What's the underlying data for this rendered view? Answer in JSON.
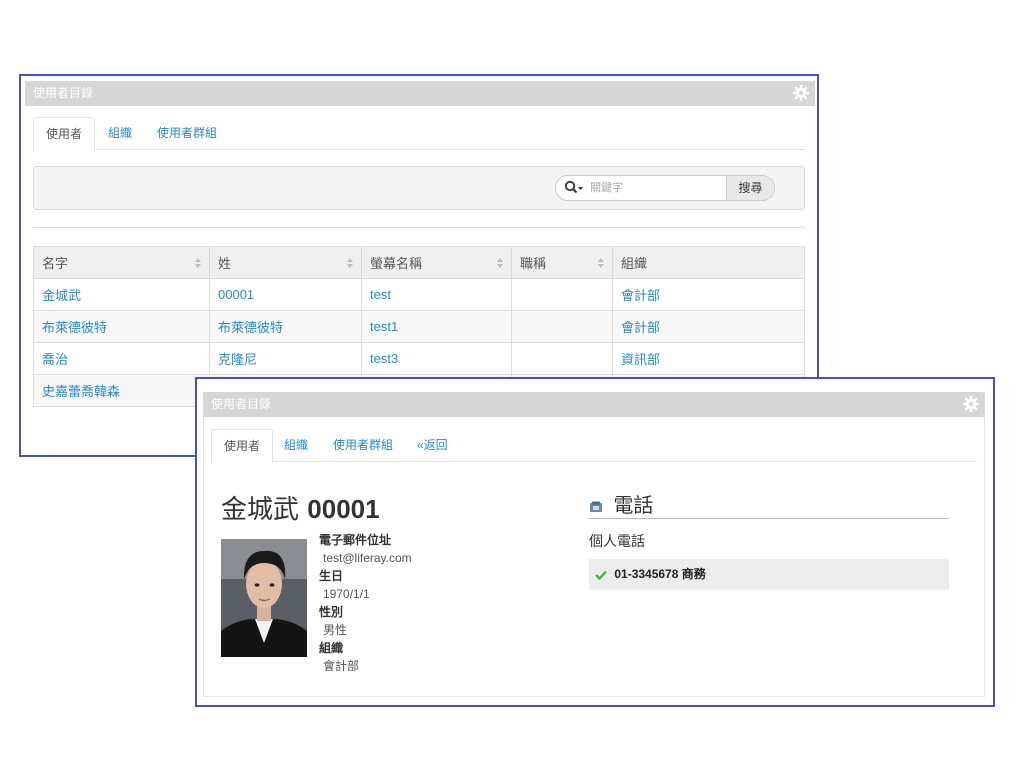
{
  "directory": {
    "title": "使用者目錄",
    "tabs": [
      {
        "label": "使用者",
        "active": true
      },
      {
        "label": "組織",
        "active": false
      },
      {
        "label": "使用者群組",
        "active": false
      }
    ],
    "search": {
      "placeholder": "關鍵字",
      "button": "搜尋"
    },
    "columns": [
      "名字",
      "姓",
      "螢幕名稱",
      "職稱",
      "組織"
    ],
    "rows": [
      [
        "金城武",
        "00001",
        "test",
        "",
        "會計部"
      ],
      [
        "布萊德彼特",
        "布萊德彼特",
        "test1",
        "",
        "會計部"
      ],
      [
        "喬治",
        "克隆尼",
        "test3",
        "",
        "資訊部"
      ],
      [
        "史嘉蕾喬韓森",
        "",
        "",
        "",
        ""
      ]
    ]
  },
  "detail": {
    "title": "使用者目錄",
    "tabs": [
      {
        "label": "使用者",
        "active": true
      },
      {
        "label": "組織",
        "active": false
      },
      {
        "label": "使用者群組",
        "active": false
      },
      {
        "label": "«返回",
        "active": false
      }
    ],
    "user": {
      "first_name": "金城武",
      "last_name": "00001",
      "email_label": "電子郵件位址",
      "email": "test@liferay.com",
      "birthday_label": "生日",
      "birthday": "1970/1/1",
      "gender_label": "性別",
      "gender": "男性",
      "org_label": "組織",
      "org": "會計部"
    },
    "phone": {
      "heading": "電話",
      "subheading": "個人電話",
      "number": "01-3345678",
      "type": "商務"
    }
  },
  "colors": {
    "accent": "#4a4fc4",
    "link": "#2a8ac7",
    "titlebar": "#d6d6d6",
    "check": "#4caf50"
  }
}
